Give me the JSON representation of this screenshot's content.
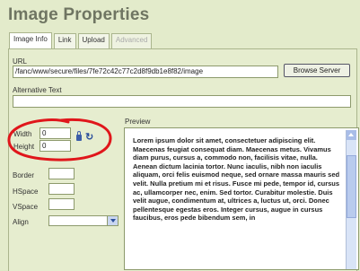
{
  "dialog": {
    "title": "Image Properties",
    "tabs": [
      {
        "label": "Image Info",
        "active": true
      },
      {
        "label": "Link",
        "active": false
      },
      {
        "label": "Upload",
        "active": false
      },
      {
        "label": "Advanced",
        "active": false,
        "disabled": true
      }
    ]
  },
  "url": {
    "label": "URL",
    "value": "/fanc/www/secure/files/7fe72c42c77c2d8f9db1e8f82/image",
    "browse_label": "Browse Server"
  },
  "alt": {
    "label": "Alternative Text",
    "value": ""
  },
  "size": {
    "width_label": "Width",
    "width_value": "0",
    "height_label": "Height",
    "height_value": "0"
  },
  "spacing": {
    "border_label": "Border",
    "hspace_label": "HSpace",
    "vspace_label": "VSpace",
    "align_label": "Align"
  },
  "preview": {
    "label": "Preview",
    "text": "Lorem ipsum dolor sit amet, consectetuer adipiscing elit. Maecenas feugiat consequat diam. Maecenas metus. Vivamus diam purus, cursus a, commodo non, facilisis vitae, nulla. Aenean dictum lacinia tortor. Nunc iaculis, nibh non iaculis aliquam, orci felis euismod neque, sed ornare massa mauris sed velit. Nulla pretium mi et risus. Fusce mi pede, tempor id, cursus ac, ullamcorper nec, enim. Sed tortor. Curabitur molestie. Duis velit augue, condimentum at, ultrices a, luctus ut, orci. Donec pellentesque egestas eros. Integer cursus, augue in cursus faucibus, eros pede bibendum sem, in"
  },
  "colors": {
    "annotation": "#e0161b",
    "accent": "#2b4f9b"
  }
}
